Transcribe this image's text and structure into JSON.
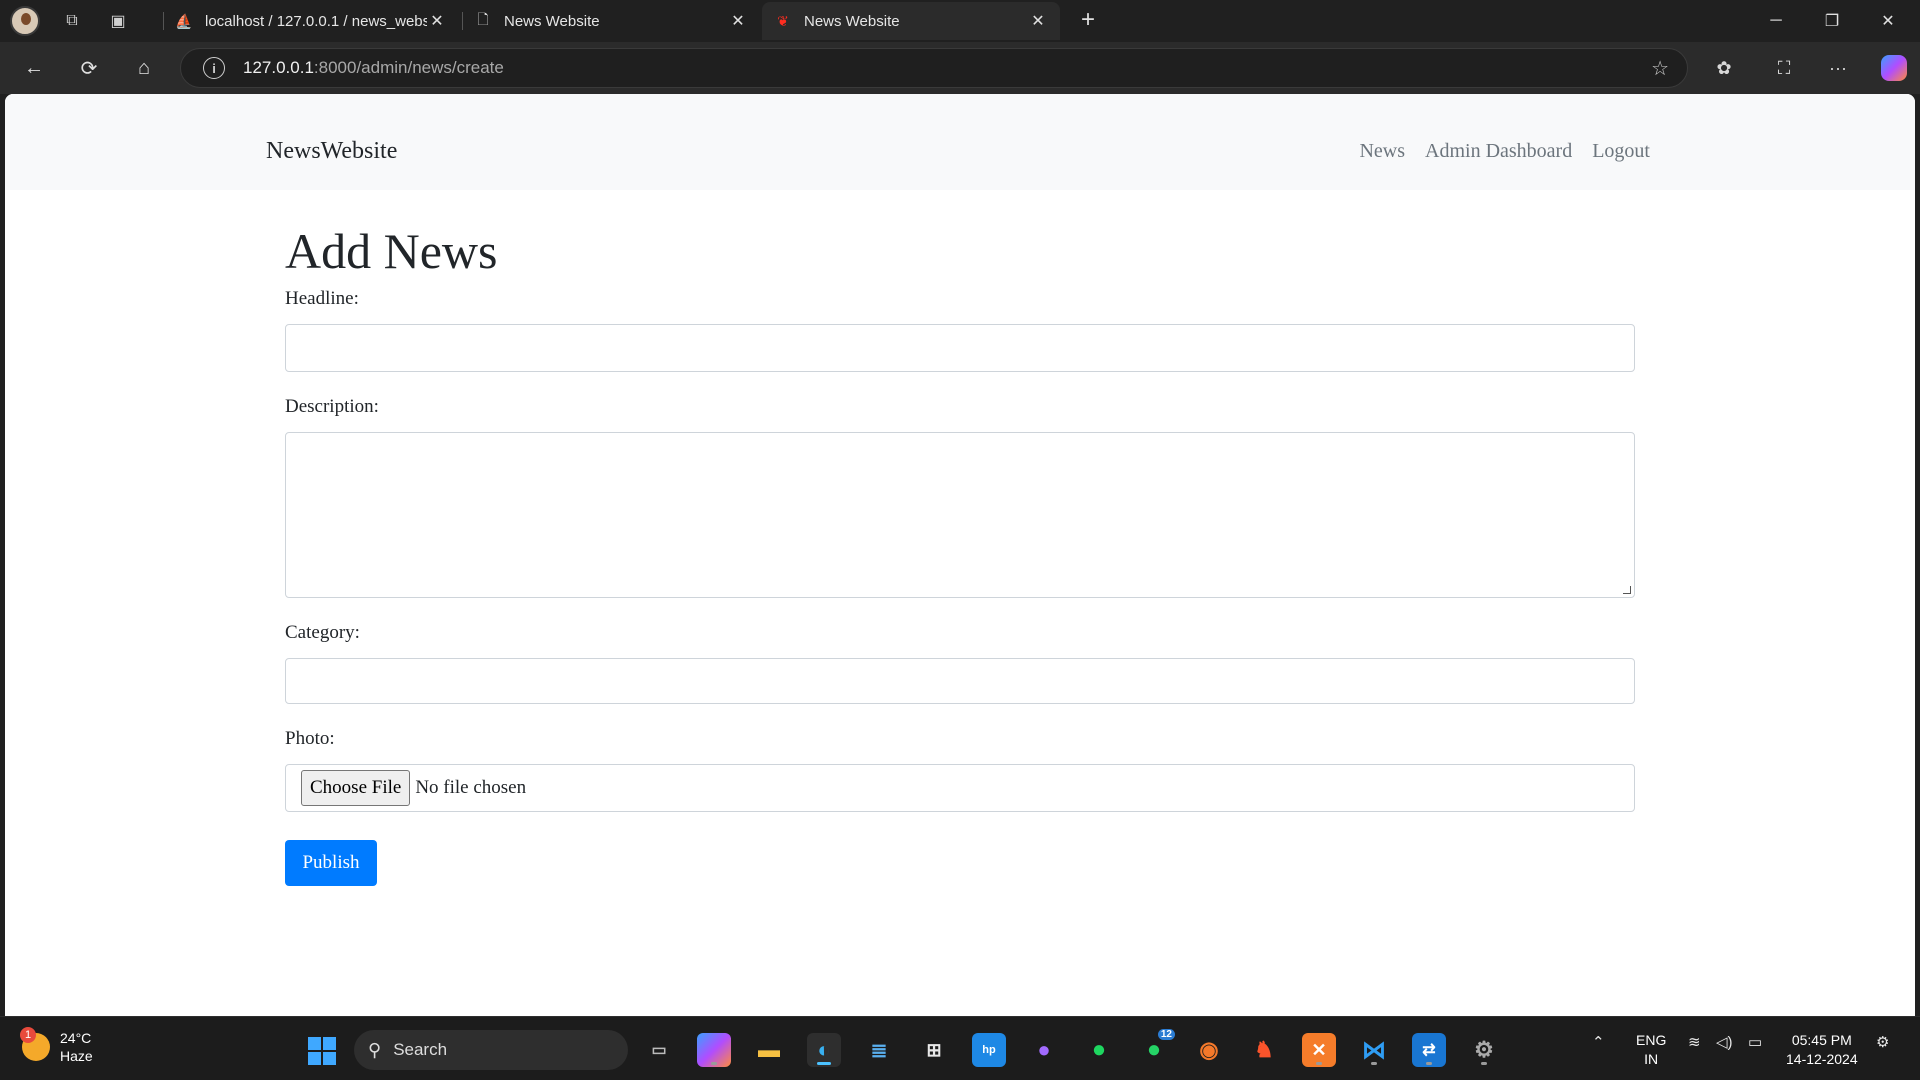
{
  "browser": {
    "tabs": [
      {
        "title": "localhost / 127.0.0.1 / news_webs",
        "favicon": "phpmyadmin-icon"
      },
      {
        "title": "News Website",
        "favicon": "page-icon"
      },
      {
        "title": "News Website",
        "favicon": "laravel-icon"
      }
    ],
    "url_host": "127.0.0.1",
    "url_rest": ":8000/admin/news/create"
  },
  "site": {
    "brand": "NewsWebsite",
    "nav": {
      "news": "News",
      "dashboard": "Admin Dashboard",
      "logout": "Logout"
    }
  },
  "form": {
    "title": "Add News",
    "headline_label": "Headline:",
    "headline_value": "",
    "description_label": "Description:",
    "description_value": "",
    "category_label": "Category:",
    "category_value": "",
    "photo_label": "Photo:",
    "choose_file": "Choose File",
    "no_file": "No file chosen",
    "publish": "Publish"
  },
  "taskbar": {
    "weather_badge": "1",
    "temperature": "24°C",
    "condition": "Haze",
    "search_placeholder": "Search",
    "whatsapp_badge": "12",
    "lang_top": "ENG",
    "lang_bottom": "IN",
    "time": "05:45 PM",
    "date": "14-12-2024"
  },
  "colors": {
    "primary": "#007bff",
    "navbar_bg": "#f8f9fa",
    "browser_bg": "#202020"
  }
}
